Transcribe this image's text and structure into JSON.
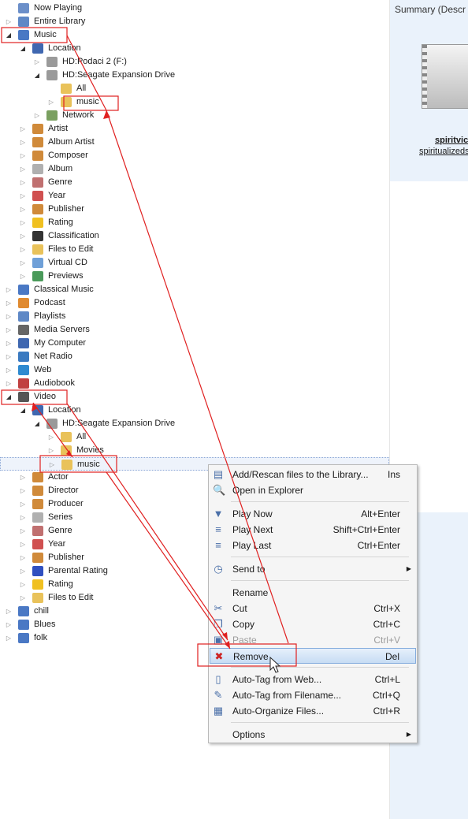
{
  "tree": [
    {
      "label": "Now Playing",
      "indent": 0,
      "expander": "none",
      "icon": "now-playing-icon",
      "color": "#6b8fc9"
    },
    {
      "label": "Entire Library",
      "indent": 0,
      "expander": "closed",
      "icon": "library-icon",
      "color": "#5e88c6"
    },
    {
      "label": "Music",
      "indent": 0,
      "expander": "open",
      "icon": "music-note-icon",
      "color": "#4a78c4"
    },
    {
      "label": "Location",
      "indent": 1,
      "expander": "open",
      "icon": "monitor-icon",
      "color": "#3f67b0"
    },
    {
      "label": "HD:Podaci 2 (F:)",
      "indent": 2,
      "expander": "closed",
      "icon": "drive-icon",
      "color": "#9a9a9a"
    },
    {
      "label": "HD:Seagate Expansion Drive",
      "indent": 2,
      "expander": "open",
      "icon": "drive-icon",
      "color": "#9a9a9a"
    },
    {
      "label": "All",
      "indent": 3,
      "expander": "none",
      "icon": "folder-icon",
      "color": "#e9c25a"
    },
    {
      "label": "music",
      "indent": 3,
      "expander": "closed",
      "icon": "music-folder-icon",
      "color": "#e9c25a"
    },
    {
      "label": "Network",
      "indent": 2,
      "expander": "closed",
      "icon": "network-icon",
      "color": "#7aa060"
    },
    {
      "label": "Artist",
      "indent": 1,
      "expander": "closed",
      "icon": "people-icon",
      "color": "#d08a3a"
    },
    {
      "label": "Album Artist",
      "indent": 1,
      "expander": "closed",
      "icon": "people-icon",
      "color": "#d08a3a"
    },
    {
      "label": "Composer",
      "indent": 1,
      "expander": "closed",
      "icon": "people-icon",
      "color": "#d08a3a"
    },
    {
      "label": "Album",
      "indent": 1,
      "expander": "closed",
      "icon": "disc-icon",
      "color": "#b0b0b0"
    },
    {
      "label": "Genre",
      "indent": 1,
      "expander": "closed",
      "icon": "genre-icon",
      "color": "#c07070"
    },
    {
      "label": "Year",
      "indent": 1,
      "expander": "closed",
      "icon": "calendar-icon",
      "color": "#d05050"
    },
    {
      "label": "Publisher",
      "indent": 1,
      "expander": "closed",
      "icon": "people-icon",
      "color": "#d08a3a"
    },
    {
      "label": "Rating",
      "indent": 1,
      "expander": "closed",
      "icon": "star-icon",
      "color": "#f0c020"
    },
    {
      "label": "Classification",
      "indent": 1,
      "expander": "closed",
      "icon": "classification-icon",
      "color": "#333333"
    },
    {
      "label": "Files to Edit",
      "indent": 1,
      "expander": "closed",
      "icon": "edit-files-icon",
      "color": "#e9c25a"
    },
    {
      "label": "Virtual CD",
      "indent": 1,
      "expander": "closed",
      "icon": "cd-icon",
      "color": "#6fa0d8"
    },
    {
      "label": "Previews",
      "indent": 1,
      "expander": "closed",
      "icon": "previews-icon",
      "color": "#4a9a5a"
    },
    {
      "label": "Classical Music",
      "indent": 0,
      "expander": "closed",
      "icon": "music-note-icon",
      "color": "#4a78c4"
    },
    {
      "label": "Podcast",
      "indent": 0,
      "expander": "closed",
      "icon": "podcast-icon",
      "color": "#e08a30"
    },
    {
      "label": "Playlists",
      "indent": 0,
      "expander": "closed",
      "icon": "playlists-icon",
      "color": "#5e88c6"
    },
    {
      "label": "Media Servers",
      "indent": 0,
      "expander": "closed",
      "icon": "media-server-icon",
      "color": "#666666"
    },
    {
      "label": "My Computer",
      "indent": 0,
      "expander": "closed",
      "icon": "computer-icon",
      "color": "#3f67b0"
    },
    {
      "label": "Net Radio",
      "indent": 0,
      "expander": "closed",
      "icon": "radio-icon",
      "color": "#3a7ac0"
    },
    {
      "label": "Web",
      "indent": 0,
      "expander": "closed",
      "icon": "globe-icon",
      "color": "#2f8ad0"
    },
    {
      "label": "Audiobook",
      "indent": 0,
      "expander": "closed",
      "icon": "audiobook-icon",
      "color": "#c04040"
    },
    {
      "label": "Video",
      "indent": 0,
      "expander": "open",
      "icon": "video-icon",
      "color": "#555555"
    },
    {
      "label": "Location",
      "indent": 1,
      "expander": "open",
      "icon": "monitor-icon",
      "color": "#3f67b0"
    },
    {
      "label": "HD:Seagate Expansion Drive",
      "indent": 2,
      "expander": "open",
      "icon": "drive-icon",
      "color": "#9a9a9a"
    },
    {
      "label": "All",
      "indent": 3,
      "expander": "closed",
      "icon": "folder-icon",
      "color": "#e9c25a"
    },
    {
      "label": "Movies",
      "indent": 3,
      "expander": "closed",
      "icon": "folder-icon",
      "color": "#e9c25a"
    },
    {
      "label": "music",
      "indent": 3,
      "expander": "closed",
      "icon": "music-folder-icon",
      "color": "#e9c25a",
      "selected": true
    },
    {
      "label": "Actor",
      "indent": 1,
      "expander": "closed",
      "icon": "people-icon",
      "color": "#d08a3a"
    },
    {
      "label": "Director",
      "indent": 1,
      "expander": "closed",
      "icon": "people-icon",
      "color": "#d08a3a"
    },
    {
      "label": "Producer",
      "indent": 1,
      "expander": "closed",
      "icon": "people-icon",
      "color": "#d08a3a"
    },
    {
      "label": "Series",
      "indent": 1,
      "expander": "closed",
      "icon": "disc-icon",
      "color": "#b0b0b0"
    },
    {
      "label": "Genre",
      "indent": 1,
      "expander": "closed",
      "icon": "genre-icon",
      "color": "#c07070"
    },
    {
      "label": "Year",
      "indent": 1,
      "expander": "closed",
      "icon": "calendar-icon",
      "color": "#d05050"
    },
    {
      "label": "Publisher",
      "indent": 1,
      "expander": "closed",
      "icon": "people-icon",
      "color": "#d08a3a"
    },
    {
      "label": "Parental Rating",
      "indent": 1,
      "expander": "closed",
      "icon": "parental-rating-icon",
      "color": "#3050c0"
    },
    {
      "label": "Rating",
      "indent": 1,
      "expander": "closed",
      "icon": "star-icon",
      "color": "#f0c020"
    },
    {
      "label": "Files to Edit",
      "indent": 1,
      "expander": "closed",
      "icon": "edit-files-icon",
      "color": "#e9c25a"
    },
    {
      "label": "chill",
      "indent": 0,
      "expander": "closed",
      "icon": "music-note-icon",
      "color": "#4a78c4"
    },
    {
      "label": "Blues",
      "indent": 0,
      "expander": "closed",
      "icon": "music-note-icon",
      "color": "#4a78c4"
    },
    {
      "label": "folk",
      "indent": 0,
      "expander": "closed",
      "icon": "music-note-icon",
      "color": "#4a78c4"
    }
  ],
  "right_panel": {
    "title": "Summary (Descr",
    "file_name": "spiritvic",
    "file_sub": "spiritualizeds"
  },
  "context_menu": [
    {
      "type": "item",
      "label": "Add/Rescan files to the Library...",
      "shortcut": "Ins",
      "icon": "add-rescan-icon",
      "glyph": "▤"
    },
    {
      "type": "item",
      "label": "Open in Explorer",
      "shortcut": "",
      "icon": "explorer-icon",
      "glyph": "🔍"
    },
    {
      "type": "sep"
    },
    {
      "type": "item",
      "label": "Play Now",
      "shortcut": "Alt+Enter",
      "icon": "play-now-icon",
      "glyph": "▼"
    },
    {
      "type": "item",
      "label": "Play Next",
      "shortcut": "Shift+Ctrl+Enter",
      "icon": "play-next-icon",
      "glyph": "≡"
    },
    {
      "type": "item",
      "label": "Play Last",
      "shortcut": "Ctrl+Enter",
      "icon": "play-last-icon",
      "glyph": "≡"
    },
    {
      "type": "sep"
    },
    {
      "type": "item",
      "label": "Send to",
      "shortcut": "",
      "icon": "send-to-icon",
      "glyph": "◷",
      "submenu": true
    },
    {
      "type": "sep"
    },
    {
      "type": "item",
      "label": "Rename",
      "shortcut": "",
      "icon": "",
      "glyph": ""
    },
    {
      "type": "item",
      "label": "Cut",
      "shortcut": "Ctrl+X",
      "icon": "cut-icon",
      "glyph": "✂"
    },
    {
      "type": "item",
      "label": "Copy",
      "shortcut": "Ctrl+C",
      "icon": "copy-icon",
      "glyph": "❐"
    },
    {
      "type": "item",
      "label": "Paste",
      "shortcut": "Ctrl+V",
      "icon": "paste-icon",
      "glyph": "▣",
      "disabled": true
    },
    {
      "type": "item",
      "label": "Remove",
      "shortcut": "Del",
      "icon": "remove-icon",
      "glyph": "✖",
      "highlighted": true
    },
    {
      "type": "sep"
    },
    {
      "type": "item",
      "label": "Auto-Tag from Web...",
      "shortcut": "Ctrl+L",
      "icon": "auto-tag-web-icon",
      "glyph": "▯"
    },
    {
      "type": "item",
      "label": "Auto-Tag from Filename...",
      "shortcut": "Ctrl+Q",
      "icon": "auto-tag-filename-icon",
      "glyph": "✎"
    },
    {
      "type": "item",
      "label": "Auto-Organize Files...",
      "shortcut": "Ctrl+R",
      "icon": "auto-organize-icon",
      "glyph": "▦"
    },
    {
      "type": "sep"
    },
    {
      "type": "item",
      "label": "Options",
      "shortcut": "",
      "icon": "",
      "glyph": "",
      "submenu": true
    }
  ],
  "colors": {
    "annotation": "#e02020",
    "selection": "#eef3fb",
    "menu_highlight": "#c7dcf4",
    "remove_icon": "#cc2222"
  }
}
